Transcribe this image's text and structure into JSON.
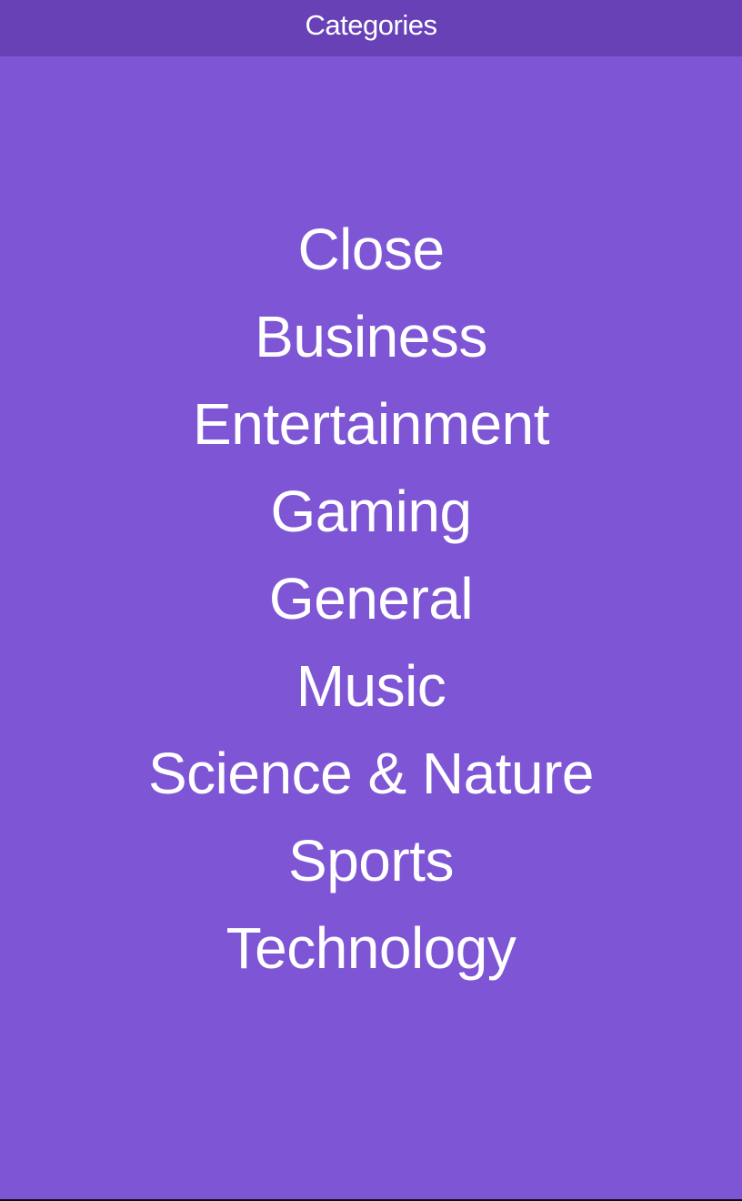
{
  "header": {
    "title": "Categories"
  },
  "menu": {
    "items": [
      {
        "label": "Close"
      },
      {
        "label": "Business"
      },
      {
        "label": "Entertainment"
      },
      {
        "label": "Gaming"
      },
      {
        "label": "General"
      },
      {
        "label": "Music"
      },
      {
        "label": "Science & Nature"
      },
      {
        "label": "Sports"
      },
      {
        "label": "Technology"
      }
    ]
  },
  "colors": {
    "background": "#7e55d4",
    "header": "#6841b7",
    "text": "#ffffff"
  }
}
